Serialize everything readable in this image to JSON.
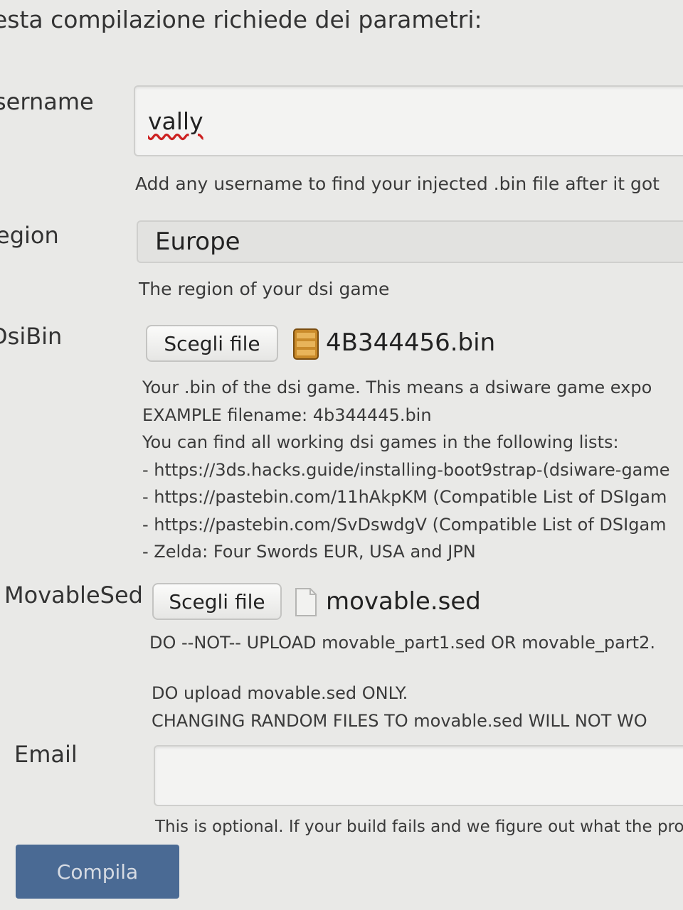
{
  "form": {
    "heading": "esta compilazione richiede dei parametri:",
    "username": {
      "label": "sername",
      "value": "vally",
      "help": "Add any username to find your injected .bin file after it got"
    },
    "region": {
      "label": "egion",
      "selected": "Europe",
      "help": "The region of your dsi game"
    },
    "dsibin": {
      "label": "DsiBin",
      "button_label": "Scegli file",
      "file_name": "4B344456.bin",
      "file_icon": "bin-file-icon",
      "help_lines": [
        "Your .bin of the dsi game. This means a dsiware game expo",
        "EXAMPLE filename: 4b344445.bin",
        "You can find all working dsi games in the following lists:",
        "- https://3ds.hacks.guide/installing-boot9strap-(dsiware-game",
        "- https://pastebin.com/11hAkpKM (Compatible List of DSIgam",
        "- https://pastebin.com/SvDswdgV (Compatible List of DSIgam",
        "- Zelda: Four Swords EUR, USA and JPN"
      ]
    },
    "movablesed": {
      "label": "MovableSed",
      "button_label": "Scegli file",
      "file_name": "movable.sed",
      "file_icon": "blank-file-icon",
      "help_warning": "DO --NOT-- UPLOAD movable_part1.sed OR movable_part2.",
      "help_lines": [
        "DO upload movable.sed ONLY.",
        "CHANGING RANDOM FILES TO movable.sed WILL NOT WO"
      ]
    },
    "email": {
      "label": "Email",
      "value": "",
      "help": "This is optional. If your build fails and we figure out what the pro"
    },
    "submit_label": "Compila"
  },
  "colors": {
    "background": "#e9e9e7",
    "submit_button": "#4a6a94",
    "spellcheck_underline": "#cc2222"
  }
}
